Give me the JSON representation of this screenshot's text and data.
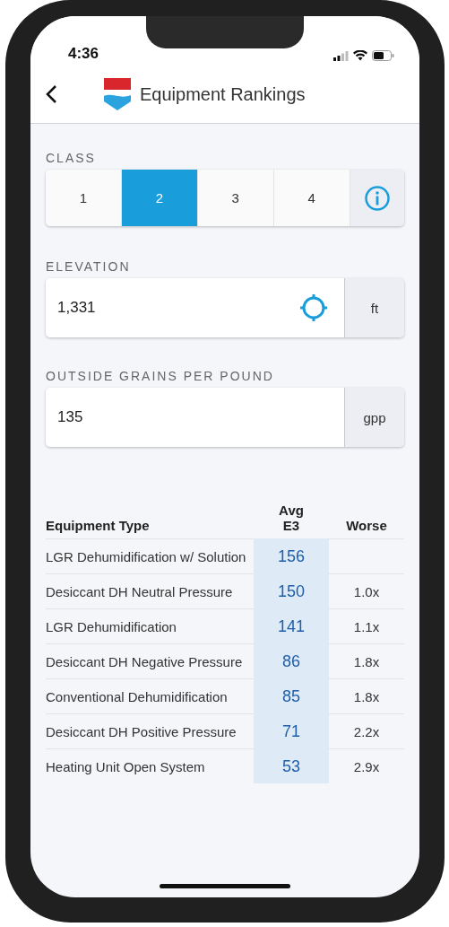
{
  "status_bar": {
    "time": "4:36"
  },
  "header": {
    "title": "Equipment Rankings"
  },
  "class": {
    "label": "CLASS",
    "options": [
      {
        "label": "1",
        "selected": false
      },
      {
        "label": "2",
        "selected": true
      },
      {
        "label": "3",
        "selected": false
      },
      {
        "label": "4",
        "selected": false
      }
    ]
  },
  "elevation": {
    "label": "ELEVATION",
    "value": "1,331",
    "unit": "ft"
  },
  "grains": {
    "label": "OUTSIDE GRAINS PER POUND",
    "value": "135",
    "unit": "gpp"
  },
  "table": {
    "columns": [
      "Equipment Type",
      "Avg E3",
      "Worse"
    ],
    "rows": [
      {
        "type": "LGR Dehumidification w/ Solution",
        "avg": "156"
      },
      {
        "type": "Desiccant DH Neutral Pressure",
        "avg": "150",
        "worse": "1.0x"
      },
      {
        "type": "LGR Dehumidification",
        "avg": "141",
        "worse": "1.1x"
      },
      {
        "type": "Desiccant DH Negative Pressure",
        "avg": "86",
        "worse": "1.8x"
      },
      {
        "type": "Conventional Dehumidification",
        "avg": "85",
        "worse": "1.8x"
      },
      {
        "type": "Desiccant DH Positive Pressure",
        "avg": "71",
        "worse": "2.2x"
      },
      {
        "type": "Heating Unit Open System",
        "avg": "53",
        "worse": "2.9x"
      }
    ]
  }
}
